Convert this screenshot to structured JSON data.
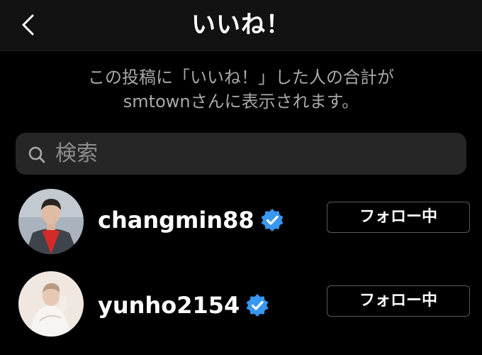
{
  "header": {
    "title": "いいね！",
    "back_icon": "chevron-left-icon"
  },
  "notice": {
    "line1": "この投稿に「いいね！」した人の合計が",
    "line2": "smtownさんに表示されます。"
  },
  "search": {
    "placeholder": "検索",
    "icon": "search-icon"
  },
  "users": [
    {
      "username": "changmin88",
      "verified": true,
      "follow_label": "フォロー中"
    },
    {
      "username": "yunho2154",
      "verified": true,
      "follow_label": "フォロー中"
    }
  ],
  "colors": {
    "background": "#000000",
    "header_bg": "#121212",
    "search_bg": "#262626",
    "secondary_text": "#a8a8a8",
    "verified_blue": "#3897f0",
    "button_border": "#5a5a5a"
  }
}
